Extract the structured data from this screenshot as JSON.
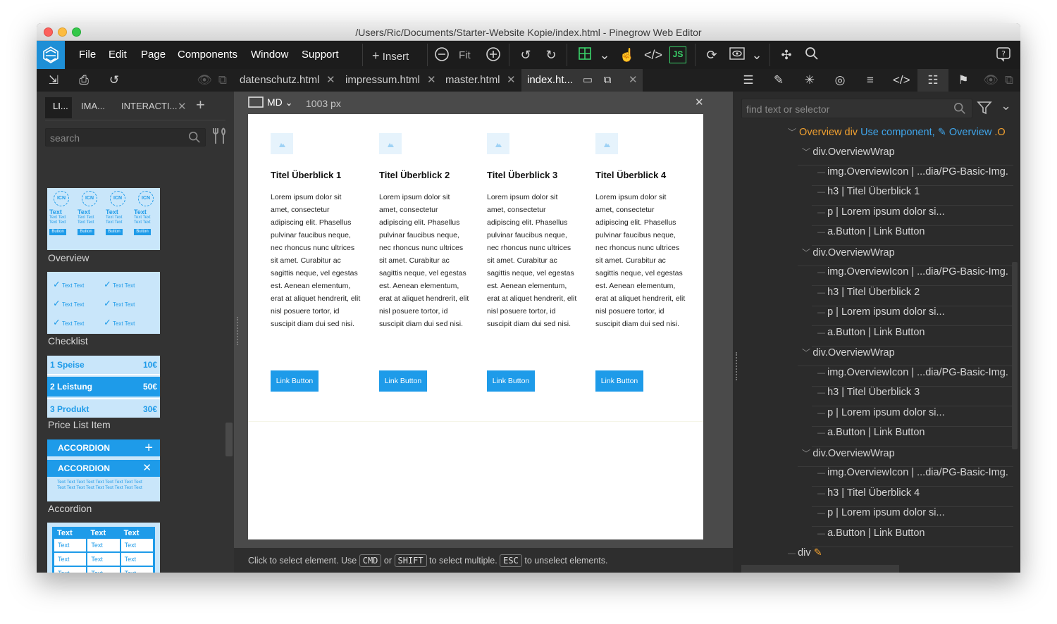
{
  "window": {
    "title": "/Users/Ric/Documents/Starter-Website Kopie/index.html - Pinegrow Web Editor"
  },
  "menu": {
    "items": [
      "File",
      "Edit",
      "Page",
      "Components",
      "Window",
      "Support"
    ],
    "insert_label": "Insert",
    "fit_label": "Fit"
  },
  "file_tabs": [
    "datenschutz.html",
    "impressum.html",
    "master.html",
    "index.ht..."
  ],
  "library": {
    "tabs": [
      "LI...",
      "IMA...",
      "INTERACTI..."
    ],
    "search_placeholder": "search",
    "thumbs": {
      "overview": {
        "icon_label": "ICN",
        "heading": "Text",
        "body": "Text Text Text Text",
        "button": "Button"
      },
      "checklist": {
        "item": "Text Text"
      },
      "price": {
        "rows": [
          {
            "label": "1  Speise",
            "price": "10€"
          },
          {
            "label": "2  Leistung",
            "price": "50€"
          },
          {
            "label": "3  Produkt",
            "price": "30€"
          }
        ]
      },
      "accordion": {
        "header": "ACCORDION",
        "body": "Text Text Text Text Text Text Text Text Text Text Text Text Text Text Text Text Text Text"
      },
      "table": {
        "header": [
          "Text",
          "Text",
          "Text"
        ],
        "cell": "Text"
      }
    },
    "items": [
      "Overview",
      "Checklist",
      "Price List Item",
      "Accordion"
    ]
  },
  "canvas": {
    "breakpoint": "MD",
    "width_label": "1003 px",
    "columns": [
      {
        "title": "Titel Überblick 1",
        "text": "Lorem ipsum dolor sit amet, consectetur adipiscing elit. Phasellus pulvinar faucibus neque, nec rhoncus nunc ultrices sit amet. Curabitur ac sagittis neque, vel egestas est. Aenean elementum, erat at aliquet hendrerit, elit nisl posuere tortor, id suscipit diam dui sed nisi.",
        "button": "Link Button"
      },
      {
        "title": "Titel Überblick 2",
        "text": "Lorem ipsum dolor sit amet, consectetur adipiscing elit. Phasellus pulvinar faucibus neque, nec rhoncus nunc ultrices sit amet. Curabitur ac sagittis neque, vel egestas est. Aenean elementum, erat at aliquet hendrerit, elit nisl posuere tortor, id suscipit diam dui sed nisi.",
        "button": "Link Button"
      },
      {
        "title": "Titel Überblick 3",
        "text": "Lorem ipsum dolor sit amet, consectetur adipiscing elit. Phasellus pulvinar faucibus neque, nec rhoncus nunc ultrices sit amet. Curabitur ac sagittis neque, vel egestas est. Aenean elementum, erat at aliquet hendrerit, elit nisl posuere tortor, id suscipit diam dui sed nisi.",
        "button": "Link Button"
      },
      {
        "title": "Titel Überblick 4",
        "text": "Lorem ipsum dolor sit amet, consectetur adipiscing elit. Phasellus pulvinar faucibus neque, nec rhoncus nunc ultrices sit amet. Curabitur ac sagittis neque, vel egestas est. Aenean elementum, erat at aliquet hendrerit, elit nisl posuere tortor, id suscipit diam dui sed nisi.",
        "button": "Link Button"
      }
    ]
  },
  "status": {
    "part1": "Click to select element. Use",
    "kbd1": "CMD",
    "or": "or",
    "kbd2": "SHIFT",
    "part2": "to select multiple.",
    "kbd3": "ESC",
    "part3": "to unselect elements."
  },
  "tree": {
    "search_placeholder": "find text or selector",
    "root": {
      "name": "Overview div",
      "use_component": "Use component,",
      "component": "Overview",
      "suffix": ".O"
    },
    "wraps": [
      {
        "label": "div.OverviewWrap",
        "children": [
          "img.OverviewIcon | ...dia/PG-Basic-Img.",
          "h3 | Titel Überblick 1",
          "p | Lorem ipsum dolor si...",
          "a.Button | Link Button"
        ]
      },
      {
        "label": "div.OverviewWrap",
        "children": [
          "img.OverviewIcon | ...dia/PG-Basic-Img.",
          "h3 | Titel Überblick 2",
          "p | Lorem ipsum dolor si...",
          "a.Button | Link Button"
        ]
      },
      {
        "label": "div.OverviewWrap",
        "children": [
          "img.OverviewIcon | ...dia/PG-Basic-Img.",
          "h3 | Titel Überblick 3",
          "p | Lorem ipsum dolor si...",
          "a.Button | Link Button"
        ]
      },
      {
        "label": "div.OverviewWrap",
        "children": [
          "img.OverviewIcon | ...dia/PG-Basic-Img.",
          "h3 | Titel Überblick 4",
          "p | Lorem ipsum dolor si...",
          "a.Button | Link Button"
        ]
      }
    ],
    "last": "div"
  },
  "colors": {
    "accent": "#1e9be9",
    "thumb_bg": "#c9e6fa",
    "highlight_orange": "#f0a030"
  }
}
